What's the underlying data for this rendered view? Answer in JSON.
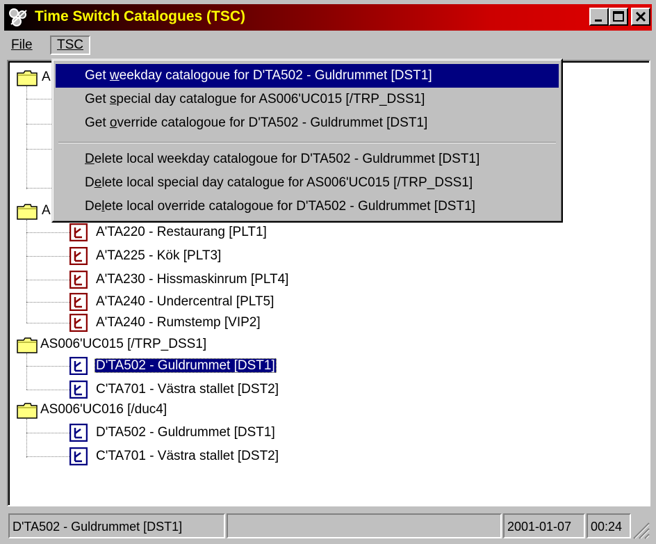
{
  "window": {
    "title": "Time Switch Catalogues (TSC)",
    "controls": [
      "minimize",
      "maximize",
      "close"
    ]
  },
  "menubar": {
    "file": "File",
    "tsc": "TSC"
  },
  "tsc_menu": {
    "items": [
      {
        "pre": "Get ",
        "key": "w",
        "post": "eekday catalogoue for D'TA502 - Guldrummet [DST1]",
        "highlighted": true
      },
      {
        "pre": "Get ",
        "key": "s",
        "post": "pecial day catalogue for AS006'UC015 [/TRP_DSS1]",
        "highlighted": false
      },
      {
        "pre": "Get ",
        "key": "o",
        "post": "verride catalogoue for D'TA502 - Guldrummet [DST1]",
        "highlighted": false
      },
      {
        "pre": "",
        "key": "D",
        "post": "elete local weekday catalogoue for D'TA502 - Guldrummet [DST1]",
        "highlighted": false
      },
      {
        "pre": "D",
        "key": "e",
        "post": "lete local special day catalogue for AS006'UC015 [/TRP_DSS1]",
        "highlighted": false
      },
      {
        "pre": "De",
        "key": "l",
        "post": "ete local override catalogoue for D'TA502 - Guldrummet [DST1]",
        "highlighted": false
      }
    ]
  },
  "tree": {
    "folder_a1_prefix": "A",
    "folder_a2_prefix": "A",
    "group_a2_children": [
      "A'TA220 - Restaurang [PLT1]",
      "A'TA225 - Kök [PLT3]",
      "A'TA230 - Hissmaskinrum [PLT4]",
      "A'TA240 - Undercentral [PLT5]",
      "A'TA240 - Rumstemp [VIP2]"
    ],
    "folder_uc015": "AS006'UC015 [/TRP_DSS1]",
    "uc015_children": [
      "D'TA502 - Guldrummet [DST1]",
      "C'TA701 - Västra stallet [DST2]"
    ],
    "folder_uc016": "AS006'UC016 [/duc4]",
    "uc016_children": [
      "D'TA502 - Guldrummet [DST1]",
      "C'TA701 - Västra stallet [DST2]"
    ],
    "selected": "D'TA502 - Guldrummet [DST1]"
  },
  "statusbar": {
    "selection": "D'TA502 - Guldrummet [DST1]",
    "empty": "",
    "date": "2001-01-07",
    "time": "00:24"
  },
  "colors": {
    "title_text": "#ffff00",
    "title_gradient_end": "#e00000",
    "highlight": "#000080",
    "red_icon": "#8b0000",
    "blue_icon": "#000080",
    "folder": "#ffff80"
  }
}
